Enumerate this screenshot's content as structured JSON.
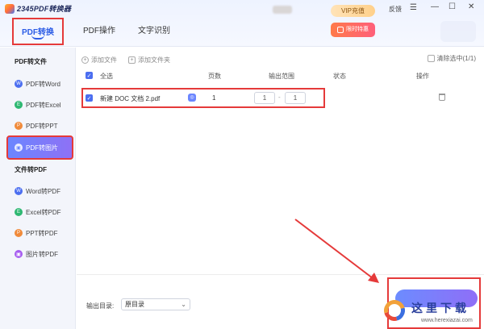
{
  "app": {
    "title": "2345PDF转换器"
  },
  "titlebar": {
    "vip": "VIP充值",
    "limited": "限时特惠",
    "feedback": "反馈",
    "menu_icon": "menu-icon",
    "min_icon": "minimize-icon",
    "max_icon": "maximize-icon",
    "close_icon": "close-icon"
  },
  "tabs": [
    {
      "label": "PDF转换",
      "active": true
    },
    {
      "label": "PDF操作",
      "active": false
    },
    {
      "label": "文字识别",
      "active": false
    }
  ],
  "sidebar": {
    "section1": "PDF转文件",
    "items1": [
      {
        "label": "PDF转Word",
        "color": "#4b6ef0"
      },
      {
        "label": "PDF转Excel",
        "color": "#2eb872"
      },
      {
        "label": "PDF转PPT",
        "color": "#f08a3a"
      },
      {
        "label": "PDF转图片",
        "color": "#ffffff",
        "active": true
      }
    ],
    "section2": "文件转PDF",
    "items2": [
      {
        "label": "Word转PDF",
        "color": "#4b6ef0"
      },
      {
        "label": "Excel转PDF",
        "color": "#2eb872"
      },
      {
        "label": "PPT转PDF",
        "color": "#f08a3a"
      },
      {
        "label": "图片转PDF",
        "color": "#a65cf0"
      }
    ]
  },
  "toolbar": {
    "add_file": "添加文件",
    "add_folder": "添加文件夹",
    "clear": "清除选中(1/1)"
  },
  "table": {
    "headers": {
      "select_all": "全选",
      "pages": "页数",
      "range": "输出范围",
      "status": "状态",
      "action": "操作"
    },
    "rows": [
      {
        "name": "新建 DOC 文档 2.pdf",
        "pages": "1",
        "from": "1",
        "to": "1",
        "sep": "-"
      }
    ]
  },
  "output": {
    "label": "输出目录:",
    "value": "原目录"
  },
  "watermark": {
    "cn": "这里下载",
    "url": "www.herexiazai.com"
  },
  "colors": {
    "accent": "#2c5de6",
    "highlight": "#e53a3a"
  }
}
